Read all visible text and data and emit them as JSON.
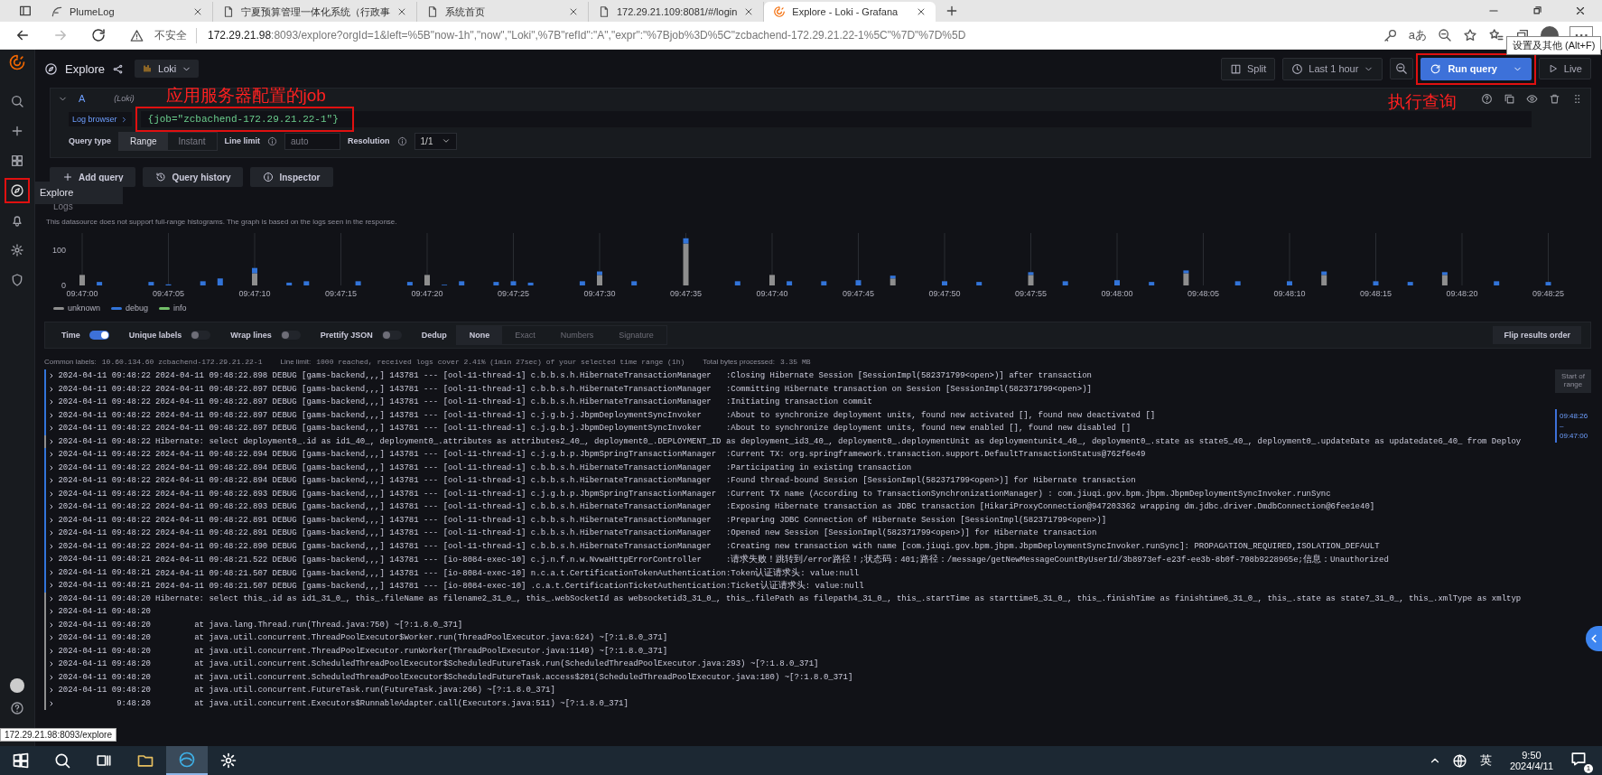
{
  "browser": {
    "tabs": [
      {
        "kind": "feather",
        "title": "PlumeLog",
        "selected": false
      },
      {
        "kind": "page",
        "title": "宁夏预算管理一体化系统（行政事",
        "selected": false
      },
      {
        "kind": "page",
        "title": "系统首页",
        "selected": false
      },
      {
        "kind": "page",
        "title": "172.29.21.109:8081/#/login",
        "selected": false
      },
      {
        "kind": "grafana",
        "title": "Explore - Loki - Grafana",
        "selected": true
      }
    ],
    "security": "不安全",
    "url_host": "172.29.21.98",
    "url_rest": ":8093/explore?orgId=1&left=%5B\"now-1h\",\"now\",\"Loki\",%7B\"refId\":\"A\",\"expr\":\"%7Bjob%3D%5C\"zcbachend-172.29.21.22-1%5C\"%7D\"%7D%5D",
    "read_aloud": "aあ",
    "tooltip": "设置及其他 (Alt+F)",
    "status_url": "172.29.21.98:8093/explore"
  },
  "sidebar": {
    "items": [
      {
        "kind": "search",
        "selected": false,
        "highlighted": false
      },
      {
        "kind": "plus",
        "selected": false,
        "highlighted": false
      },
      {
        "kind": "dashboards",
        "selected": false,
        "highlighted": false
      },
      {
        "kind": "explore",
        "selected": true,
        "highlighted": true
      },
      {
        "kind": "alerting",
        "selected": false,
        "highlighted": false
      },
      {
        "kind": "config",
        "selected": false,
        "highlighted": false
      },
      {
        "kind": "shield",
        "selected": false,
        "highlighted": false
      }
    ],
    "tooltip": "Explore"
  },
  "toolbar": {
    "title": "Explore",
    "datasource": "Loki",
    "split": "Split",
    "time_range": "Last 1 hour",
    "run_query": "Run query",
    "run_query_highlighted": true,
    "run_query_note": "执行查询",
    "live": "Live"
  },
  "query": {
    "ref": "A",
    "datasource": "(Loki)",
    "log_browser": "Log browser",
    "expression": "{job=\"zcbachend-172.29.21.22-1\"}",
    "highlighted": true,
    "note": "应用服务器配置的job",
    "query_type_label": "Query type",
    "query_types": [
      {
        "label": "Range",
        "selected": true
      },
      {
        "label": "Instant",
        "selected": false
      }
    ],
    "line_limit_label": "Line limit",
    "line_limit_placeholder": "auto",
    "resolution_label": "Resolution",
    "resolution": "1/1"
  },
  "actions": [
    {
      "kind": "plus",
      "label": "Add query"
    },
    {
      "kind": "history",
      "label": "Query history"
    },
    {
      "kind": "info",
      "label": "Inspector"
    }
  ],
  "logs_panel": {
    "title": "Logs",
    "note": "This datasource does not support full-range histograms. The graph is based on the logs seen in the response.",
    "chart_data": {
      "type": "bar",
      "stacked": true,
      "grid": true,
      "categories": [
        "09:47:00",
        null,
        null,
        null,
        null,
        "09:47:05",
        null,
        null,
        null,
        null,
        "09:47:10",
        null,
        null,
        null,
        null,
        "09:47:15",
        null,
        null,
        null,
        null,
        "09:47:20",
        null,
        null,
        null,
        null,
        "09:47:25",
        null,
        null,
        null,
        null,
        "09:47:30",
        null,
        null,
        null,
        null,
        "09:47:35",
        null,
        null,
        null,
        null,
        "09:47:40",
        null,
        null,
        null,
        null,
        "09:47:45",
        null,
        null,
        null,
        null,
        "09:47:50",
        null,
        null,
        null,
        null,
        "09:47:55",
        null,
        null,
        null,
        null,
        "09:48:00",
        null,
        null,
        null,
        null,
        "09:48:05",
        null,
        null,
        null,
        null,
        "09:48:10",
        null,
        null,
        null,
        null,
        "09:48:15",
        null,
        null,
        null,
        null,
        "09:48:20",
        null,
        null,
        null,
        null,
        "09:48:25"
      ],
      "series": [
        {
          "name": "unknown",
          "color": "#8e8e8e",
          "values": [
            30,
            0,
            0,
            0,
            0,
            0,
            0,
            0,
            0,
            0,
            35,
            0,
            0,
            0,
            0,
            0,
            0,
            0,
            0,
            0,
            30,
            0,
            0,
            0,
            0,
            0,
            0,
            0,
            0,
            0,
            30,
            0,
            0,
            0,
            0,
            120,
            0,
            0,
            0,
            0,
            30,
            0,
            0,
            0,
            0,
            0,
            0,
            20,
            0,
            0,
            0,
            0,
            0,
            0,
            0,
            30,
            0,
            0,
            0,
            0,
            0,
            0,
            0,
            0,
            35,
            0,
            0,
            0,
            0,
            0,
            0,
            0,
            30,
            0,
            0,
            0,
            0,
            0,
            0,
            30,
            0,
            0,
            0,
            0,
            0,
            0
          ]
        },
        {
          "name": "debug",
          "color": "#3274d9",
          "values": [
            0,
            10,
            0,
            0,
            10,
            3,
            0,
            12,
            20,
            0,
            15,
            0,
            8,
            12,
            0,
            0,
            12,
            0,
            0,
            10,
            0,
            2,
            12,
            0,
            10,
            12,
            8,
            0,
            0,
            12,
            10,
            0,
            12,
            0,
            0,
            15,
            0,
            0,
            12,
            0,
            0,
            12,
            0,
            12,
            0,
            15,
            0,
            8,
            0,
            0,
            12,
            0,
            10,
            0,
            0,
            8,
            0,
            12,
            0,
            0,
            15,
            0,
            10,
            0,
            8,
            0,
            0,
            12,
            0,
            0,
            12,
            0,
            10,
            0,
            0,
            12,
            0,
            10,
            0,
            8,
            0,
            0,
            12,
            0,
            0,
            10
          ]
        },
        {
          "name": "info",
          "color": "#73bf69",
          "values": [
            0,
            0,
            0,
            0,
            0,
            0,
            0,
            0,
            0,
            0,
            0,
            0,
            0,
            0,
            0,
            0,
            0,
            0,
            0,
            0,
            0,
            0,
            0,
            0,
            0,
            0,
            0,
            0,
            0,
            0,
            0,
            0,
            0,
            0,
            0,
            0,
            0,
            0,
            0,
            0,
            0,
            0,
            0,
            0,
            0,
            0,
            0,
            0,
            0,
            0,
            0,
            0,
            0,
            0,
            0,
            0,
            0,
            0,
            0,
            0,
            0,
            0,
            0,
            0,
            0,
            0,
            0,
            0,
            0,
            0,
            0,
            0,
            0,
            0,
            0,
            0,
            0,
            0,
            0,
            0,
            0,
            0,
            0,
            0,
            0,
            0
          ]
        }
      ],
      "ylim": [
        0,
        150
      ],
      "yticks": [
        0,
        100
      ]
    }
  },
  "options": {
    "toggles": [
      {
        "label": "Time",
        "on": true
      },
      {
        "label": "Unique labels",
        "on": false
      },
      {
        "label": "Wrap lines",
        "on": false
      },
      {
        "label": "Prettify JSON",
        "on": false
      }
    ],
    "dedup_label": "Dedup",
    "dedup": [
      {
        "label": "None",
        "selected": true
      },
      {
        "label": "Exact",
        "selected": false
      },
      {
        "label": "Numbers",
        "selected": false
      },
      {
        "label": "Signature",
        "selected": false
      }
    ],
    "flip": "Flip results order"
  },
  "meta": [
    {
      "label": "Common labels:",
      "value": "10.60.134.60 zcbachend-172.29.21.22-1"
    },
    {
      "label": "Line limit:",
      "value": "1000 reached, received logs cover 2.41% (1min 27sec) of your selected time range (1h)"
    },
    {
      "label": "Total bytes processed:",
      "value": "3.35 MB"
    }
  ],
  "rows": [
    {
      "color": "#3274d9",
      "time": "2024-04-11 09:48:22",
      "line": "2024-04-11 09:48:22.898 DEBUG [gams-backend,,,] 143781 --- [ool-11-thread-1] c.b.b.s.h.HibernateTransactionManager   :Closing Hibernate Session [SessionImpl(582371799<open>)] after transaction"
    },
    {
      "color": "#3274d9",
      "time": "2024-04-11 09:48:22",
      "line": "2024-04-11 09:48:22.897 DEBUG [gams-backend,,,] 143781 --- [ool-11-thread-1] c.b.b.s.h.HibernateTransactionManager   :Committing Hibernate transaction on Session [SessionImpl(582371799<open>)]"
    },
    {
      "color": "#3274d9",
      "time": "2024-04-11 09:48:22",
      "line": "2024-04-11 09:48:22.897 DEBUG [gams-backend,,,] 143781 --- [ool-11-thread-1] c.b.b.s.h.HibernateTransactionManager   :Initiating transaction commit"
    },
    {
      "color": "#3274d9",
      "time": "2024-04-11 09:48:22",
      "line": "2024-04-11 09:48:22.897 DEBUG [gams-backend,,,] 143781 --- [ool-11-thread-1] c.j.g.b.j.JbpmDeploymentSyncInvoker     :About to synchronize deployment units, found new activated [], found new deactivated []"
    },
    {
      "color": "#3274d9",
      "time": "2024-04-11 09:48:22",
      "line": "2024-04-11 09:48:22.897 DEBUG [gams-backend,,,] 143781 --- [ool-11-thread-1] c.j.g.b.j.JbpmDeploymentSyncInvoker     :About to synchronize deployment units, found new enabled [], found new disabled []"
    },
    {
      "color": "#8e8e8e",
      "time": "2024-04-11 09:48:22",
      "line": "Hibernate: select deployment0_.id as id1_40_, deployment0_.attributes as attributes2_40_, deployment0_.DEPLOYMENT_ID as deployment_id3_40_, deployment0_.deploymentUnit as deploymentunit4_40_, deployment0_.state as state5_40_, deployment0_.updateDate as updatedate6_40_ from Deploy"
    },
    {
      "color": "#3274d9",
      "time": "2024-04-11 09:48:22",
      "line": "2024-04-11 09:48:22.894 DEBUG [gams-backend,,,] 143781 --- [ool-11-thread-1] c.j.g.b.p.JbpmSpringTransactionManager  :Current TX: org.springframework.transaction.support.DefaultTransactionStatus@762f6e49"
    },
    {
      "color": "#3274d9",
      "time": "2024-04-11 09:48:22",
      "line": "2024-04-11 09:48:22.894 DEBUG [gams-backend,,,] 143781 --- [ool-11-thread-1] c.b.b.s.h.HibernateTransactionManager   :Participating in existing transaction"
    },
    {
      "color": "#3274d9",
      "time": "2024-04-11 09:48:22",
      "line": "2024-04-11 09:48:22.894 DEBUG [gams-backend,,,] 143781 --- [ool-11-thread-1] c.b.b.s.h.HibernateTransactionManager   :Found thread-bound Session [SessionImpl(582371799<open>)] for Hibernate transaction"
    },
    {
      "color": "#3274d9",
      "time": "2024-04-11 09:48:22",
      "line": "2024-04-11 09:48:22.893 DEBUG [gams-backend,,,] 143781 --- [ool-11-thread-1] c.j.g.b.p.JbpmSpringTransactionManager  :Current TX name (According to TransactionSynchronizationManager) : com.jiuqi.gov.bpm.jbpm.JbpmDeploymentSyncInvoker.runSync"
    },
    {
      "color": "#3274d9",
      "time": "2024-04-11 09:48:22",
      "line": "2024-04-11 09:48:22.893 DEBUG [gams-backend,,,] 143781 --- [ool-11-thread-1] c.b.b.s.h.HibernateTransactionManager   :Exposing Hibernate transaction as JDBC transaction [HikariProxyConnection@947203362 wrapping dm.jdbc.driver.DmdbConnection@6fee1e40]"
    },
    {
      "color": "#3274d9",
      "time": "2024-04-11 09:48:22",
      "line": "2024-04-11 09:48:22.891 DEBUG [gams-backend,,,] 143781 --- [ool-11-thread-1] c.b.b.s.h.HibernateTransactionManager   :Preparing JDBC Connection of Hibernate Session [SessionImpl(582371799<open>)]"
    },
    {
      "color": "#3274d9",
      "time": "2024-04-11 09:48:22",
      "line": "2024-04-11 09:48:22.891 DEBUG [gams-backend,,,] 143781 --- [ool-11-thread-1] c.b.b.s.h.HibernateTransactionManager   :Opened new Session [SessionImpl(582371799<open>)] for Hibernate transaction"
    },
    {
      "color": "#3274d9",
      "time": "2024-04-11 09:48:22",
      "line": "2024-04-11 09:48:22.890 DEBUG [gams-backend,,,] 143781 --- [ool-11-thread-1] c.b.b.s.h.HibernateTransactionManager   :Creating new transaction with name [com.jiuqi.gov.bpm.jbpm.JbpmDeploymentSyncInvoker.runSync]: PROPAGATION_REQUIRED,ISOLATION_DEFAULT"
    },
    {
      "color": "#3274d9",
      "time": "2024-04-11 09:48:21",
      "line": "2024-04-11 09:48:21.522 DEBUG [gams-backend,,,] 143781 --- [io-8084-exec-10] c.j.n.f.n.w.NvwaHttpErrorController     :请求失败！跳转到/error路径！;状态码：401;路径：/message/getNewMessageCountByUserId/3b8973ef-e23f-ee3b-8b0f-708b9228965e;信息：Unauthorized"
    },
    {
      "color": "#3274d9",
      "time": "2024-04-11 09:48:21",
      "line": "2024-04-11 09:48:21.507 DEBUG [gams-backend,,,] 143781 --- [io-8084-exec-10] n.c.a.t.CertificationTokenAuthentication:Token认证请求头: value:null"
    },
    {
      "color": "#3274d9",
      "time": "2024-04-11 09:48:21",
      "line": "2024-04-11 09:48:21.507 DEBUG [gams-backend,,,] 143781 --- [io-8084-exec-10] .c.a.t.CertificationTicketAuthentication:Ticket认证请求头: value:null"
    },
    {
      "color": "#8e8e8e",
      "time": "2024-04-11 09:48:20",
      "line": "Hibernate: select this_.id as id1_31_0_, this_.fileName as filename2_31_0_, this_.webSocketId as websocketid3_31_0_, this_.filePath as filepath4_31_0_, this_.startTime as starttime5_31_0_, this_.finishTime as finishtime6_31_0_, this_.state as state7_31_0_, this_.xmlType as xmltyp"
    },
    {
      "color": "#8e8e8e",
      "time": "2024-04-11 09:48:20"
    },
    {
      "color": "#8e8e8e",
      "time": "2024-04-11 09:48:20",
      "line": "        at java.lang.Thread.run(Thread.java:750) ~[?:1.8.0_371]"
    },
    {
      "color": "#8e8e8e",
      "time": "2024-04-11 09:48:20",
      "line": "        at java.util.concurrent.ThreadPoolExecutor$Worker.run(ThreadPoolExecutor.java:624) ~[?:1.8.0_371]"
    },
    {
      "color": "#8e8e8e",
      "time": "2024-04-11 09:48:20",
      "line": "        at java.util.concurrent.ThreadPoolExecutor.runWorker(ThreadPoolExecutor.java:1149) ~[?:1.8.0_371]"
    },
    {
      "color": "#8e8e8e",
      "time": "2024-04-11 09:48:20",
      "line": "        at java.util.concurrent.ScheduledThreadPoolExecutor$ScheduledFutureTask.run(ScheduledThreadPoolExecutor.java:293) ~[?:1.8.0_371]"
    },
    {
      "color": "#8e8e8e",
      "time": "2024-04-11 09:48:20",
      "line": "        at java.util.concurrent.ScheduledThreadPoolExecutor$ScheduledFutureTask.access$201(ScheduledThreadPoolExecutor.java:180) ~[?:1.8.0_371]"
    },
    {
      "color": "#8e8e8e",
      "time": "2024-04-11 09:48:20",
      "line": "        at java.util.concurrent.FutureTask.run(FutureTask.java:266) ~[?:1.8.0_371]"
    },
    {
      "color": "#8e8e8e",
      "time": "9:48:20",
      "line": "        at java.util.concurrent.Executors$RunnableAdapter.call(Executors.java:511) ~[?:1.8.0_371]"
    }
  ],
  "range": {
    "start": "Start of range",
    "span": "09:48:26 – 09:47:00"
  },
  "taskbar": {
    "apps": [
      {
        "kind": "windows",
        "selected": false
      },
      {
        "kind": "search",
        "selected": false
      },
      {
        "kind": "taskview",
        "selected": false
      },
      {
        "kind": "folder",
        "selected": false
      },
      {
        "kind": "edge",
        "selected": true
      },
      {
        "kind": "config",
        "selected": false
      }
    ],
    "ime": "英",
    "time": "9:50",
    "date": "2024/4/11",
    "notifications": "1"
  }
}
